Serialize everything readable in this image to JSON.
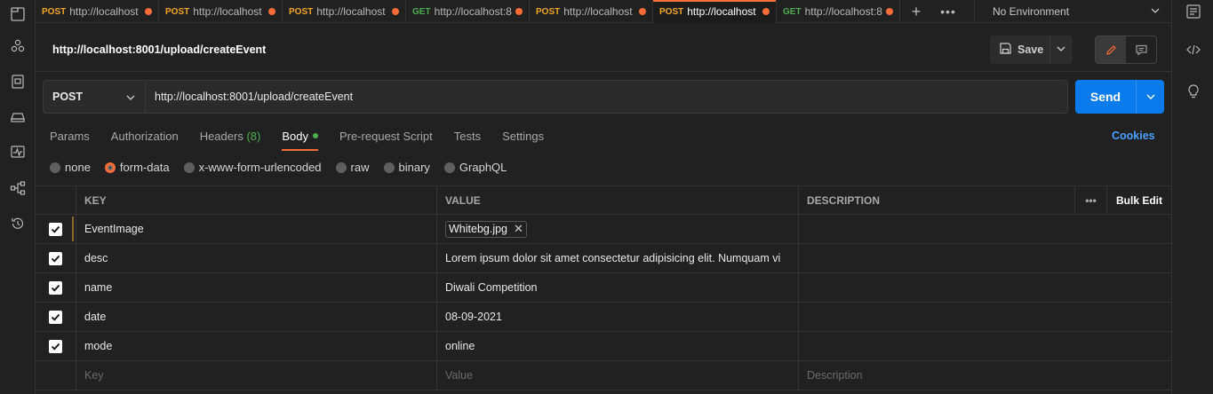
{
  "tabs": [
    {
      "method": "POST",
      "url": "http://localhost",
      "active": false
    },
    {
      "method": "POST",
      "url": "http://localhost",
      "active": false
    },
    {
      "method": "POST",
      "url": "http://localhost",
      "active": false
    },
    {
      "method": "GET",
      "url": "http://localhost:8",
      "active": false
    },
    {
      "method": "POST",
      "url": "http://localhost",
      "active": false
    },
    {
      "method": "POST",
      "url": "http://localhost",
      "active": true
    },
    {
      "method": "GET",
      "url": "http://localhost:8",
      "active": false
    }
  ],
  "tab_more": "•••",
  "environment": "No Environment",
  "request": {
    "title": "http://localhost:8001/upload/createEvent",
    "method": "POST",
    "url": "http://localhost:8001/upload/createEvent",
    "send_label": "Send",
    "save_label": "Save"
  },
  "req_tabs": {
    "params": "Params",
    "authorization": "Authorization",
    "headers": "Headers",
    "headers_count": "(8)",
    "body": "Body",
    "pre_request": "Pre-request Script",
    "tests": "Tests",
    "settings": "Settings",
    "cookies": "Cookies"
  },
  "body_types": {
    "none": "none",
    "form_data": "form-data",
    "urlencoded": "x-www-form-urlencoded",
    "raw": "raw",
    "binary": "binary",
    "graphql": "GraphQL",
    "selected": "form-data"
  },
  "table": {
    "headers": {
      "key": "KEY",
      "value": "VALUE",
      "description": "DESCRIPTION",
      "more": "•••",
      "bulk_edit": "Bulk Edit"
    },
    "rows": [
      {
        "key": "EventImage",
        "value": "Whitebg.jpg",
        "checked": true,
        "is_file": true
      },
      {
        "key": "desc",
        "value": "Lorem ipsum dolor sit amet consectetur adipisicing elit. Numquam vi",
        "checked": true
      },
      {
        "key": "name",
        "value": "Diwali Competition",
        "checked": true
      },
      {
        "key": "date",
        "value": "08-09-2021",
        "checked": true
      },
      {
        "key": "mode",
        "value": "online",
        "checked": true
      }
    ],
    "placeholders": {
      "key": "Key",
      "value": "Value",
      "description": "Description"
    }
  },
  "colors": {
    "accent": "#ff6c37",
    "send": "#097bed",
    "link": "#4aa0ff",
    "success": "#4caf50"
  }
}
